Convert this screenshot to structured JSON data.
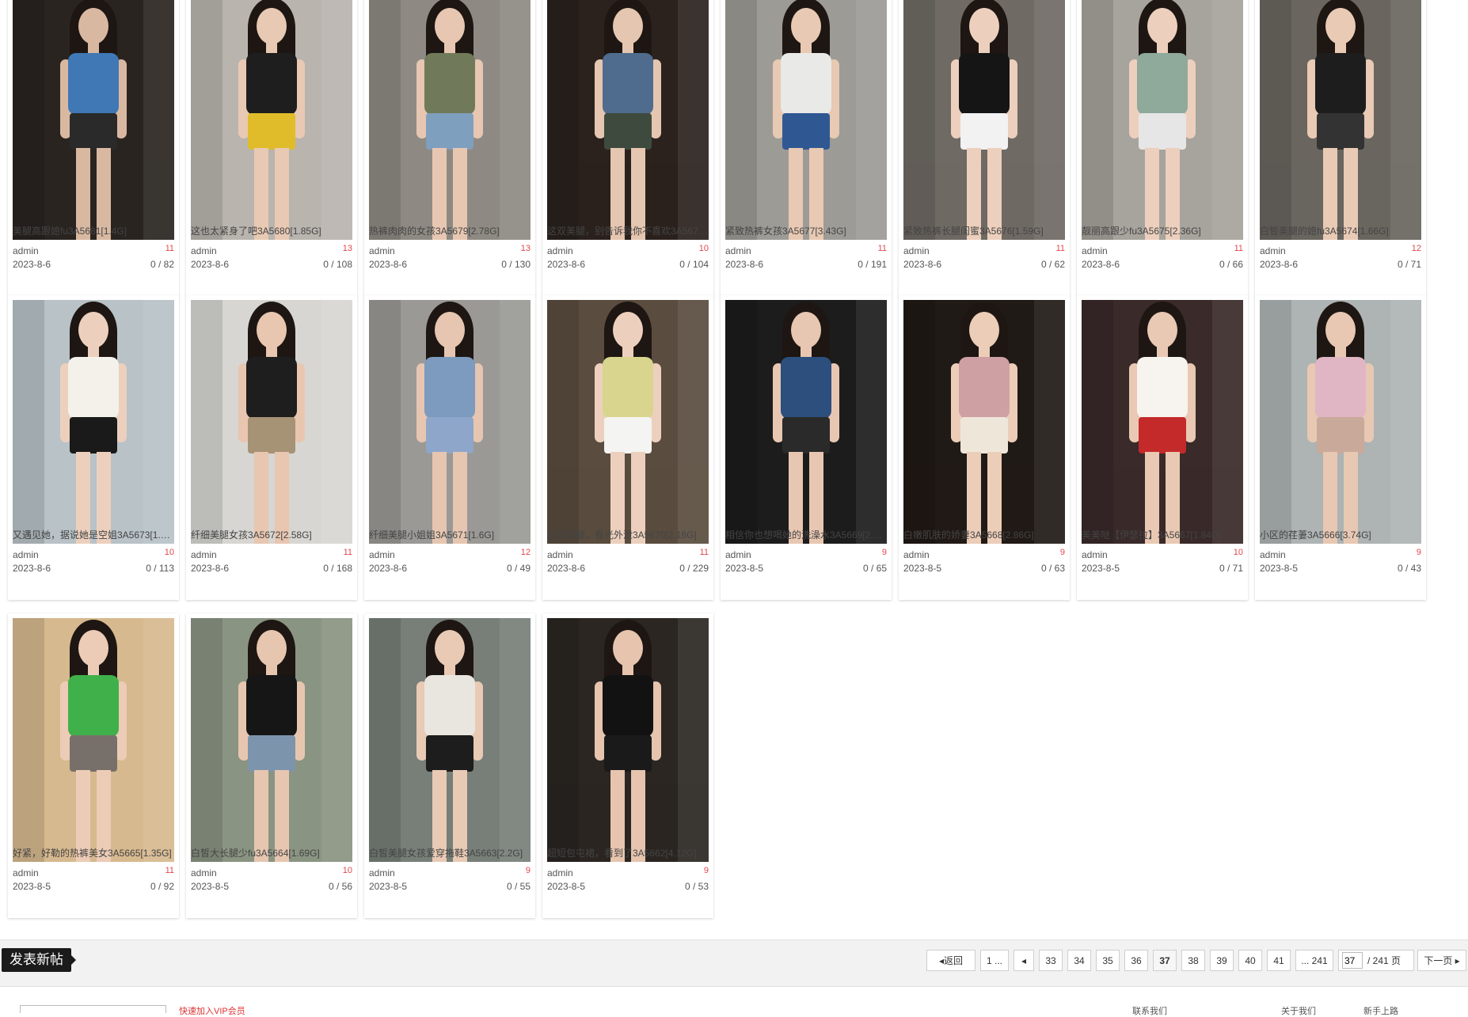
{
  "posts": [
    {
      "title": "美腿高跟媳fu3A5681[1.4G]",
      "author": "admin",
      "date": "2023-8-6",
      "count": "11",
      "stats": "0 / 82",
      "palette": [
        "#2a2420",
        "#3f78b5",
        "#d9b8a2",
        "#2a2a2a"
      ]
    },
    {
      "title": "这也太紧身了吧3A5680[1.85G]",
      "author": "admin",
      "date": "2023-8-6",
      "count": "13",
      "stats": "0 / 108",
      "palette": [
        "#b9b4ae",
        "#1e1e1e",
        "#e8c9b3",
        "#e0bc2b"
      ]
    },
    {
      "title": "热裤肉肉的女孩3A5679[2.78G]",
      "author": "admin",
      "date": "2023-8-6",
      "count": "13",
      "stats": "0 / 130",
      "palette": [
        "#8e8a83",
        "#707a5a",
        "#e7c7b2",
        "#7f9fbf"
      ]
    },
    {
      "title": "这双美腿，别告诉我你不喜欢3A5678[1.63G]",
      "author": "admin",
      "date": "2023-8-6",
      "count": "10",
      "stats": "0 / 104",
      "palette": [
        "#2b221e",
        "#4f6c8e",
        "#e5c6b0",
        "#3e4a3e"
      ]
    },
    {
      "title": "紧致热裤女孩3A5677[3.43G]",
      "author": "admin",
      "date": "2023-8-6",
      "count": "11",
      "stats": "0 / 191",
      "palette": [
        "#9d9b96",
        "#e9e9e7",
        "#e8c9b3",
        "#2f5893"
      ]
    },
    {
      "title": "紧致热裤长腿闺蜜3A5676[1.59G]",
      "author": "admin",
      "date": "2023-8-6",
      "count": "11",
      "stats": "0 / 62",
      "palette": [
        "#6f6a64",
        "#151515",
        "#ecd0bd",
        "#f2f2f2"
      ]
    },
    {
      "title": "靓丽高跟少fu3A5675[2.36G]",
      "author": "admin",
      "date": "2023-8-6",
      "count": "11",
      "stats": "0 / 66",
      "palette": [
        "#a7a39d",
        "#8fa99b",
        "#eccfbd",
        "#e6e6e6"
      ]
    },
    {
      "title": "白皙美腿的媳fu3A5674[1.66G]",
      "author": "admin",
      "date": "2023-8-6",
      "count": "12",
      "stats": "0 / 71",
      "palette": [
        "#6a665f",
        "#1d1d1d",
        "#e9cab5",
        "#333333"
      ]
    },
    {
      "title": "又遇见她，据说她是空姐3A5673[1.52G]",
      "author": "admin",
      "date": "2023-8-6",
      "count": "10",
      "stats": "0 / 113",
      "palette": [
        "#b8c2c7",
        "#f4f1ea",
        "#ecd0bd",
        "#1a1a1a"
      ]
    },
    {
      "title": "纤细美腿女孩3A5672[2.58G]",
      "author": "admin",
      "date": "2023-8-6",
      "count": "11",
      "stats": "0 / 168",
      "palette": [
        "#d7d6d2",
        "#1e1e1e",
        "#e8c6b0",
        "#a69275"
      ]
    },
    {
      "title": "纤细美腿小姐姐3A5671[1.6G]",
      "author": "admin",
      "date": "2023-8-6",
      "count": "12",
      "stats": "0 / 49",
      "palette": [
        "#9a9995",
        "#7d9abf",
        "#e6c6b1",
        "#8ea6c9"
      ]
    },
    {
      "title": "白皙美腿，春光外泄3A5670[2.16G]",
      "author": "admin",
      "date": "2023-8-6",
      "count": "11",
      "stats": "0 / 229",
      "palette": [
        "#5a4c3f",
        "#d9d58e",
        "#ecd0bd",
        "#f4f4f2"
      ]
    },
    {
      "title": "相信你也想喝她的洗澡水3A5669[2.31G]",
      "author": "admin",
      "date": "2023-8-5",
      "count": "9",
      "stats": "0 / 65",
      "palette": [
        "#1c1c1c",
        "#2c4f7e",
        "#e8c7b2",
        "#2a2a2a"
      ]
    },
    {
      "title": "白嫩肌肤的娇妻3A5668[2.86G]",
      "author": "admin",
      "date": "2023-8-5",
      "count": "9",
      "stats": "0 / 63",
      "palette": [
        "#201a16",
        "#cfa0a3",
        "#eccdb8",
        "#efe6da"
      ]
    },
    {
      "title": "美美哒【伊瑟拉】3A5667[1.84G]",
      "author": "admin",
      "date": "2023-8-5",
      "count": "10",
      "stats": "0 / 71",
      "palette": [
        "#3a2a2a",
        "#f7f3ee",
        "#e9c9b4",
        "#c42a2a"
      ]
    },
    {
      "title": "小区的荏萋3A5666[3.74G]",
      "author": "admin",
      "date": "2023-8-5",
      "count": "9",
      "stats": "0 / 43",
      "palette": [
        "#aeb3b3",
        "#e0b5c4",
        "#e8c8b3",
        "#c9a999"
      ]
    },
    {
      "title": "好紧，好勒的热裤美女3A5665[1.35G]",
      "author": "admin",
      "date": "2023-8-5",
      "count": "11",
      "stats": "0 / 92",
      "palette": [
        "#d7b98f",
        "#3fb04a",
        "#ecccb6",
        "#77706a"
      ]
    },
    {
      "title": "白皙大长腿少fu3A5664[1.69G]",
      "author": "admin",
      "date": "2023-8-5",
      "count": "10",
      "stats": "0 / 56",
      "palette": [
        "#8a9482",
        "#161616",
        "#e7c6b0",
        "#7d94ad"
      ]
    },
    {
      "title": "白皙美腿女孩爱穿拖鞋3A5663[2.2G]",
      "author": "admin",
      "date": "2023-8-5",
      "count": "9",
      "stats": "0 / 55",
      "palette": [
        "#777f78",
        "#e9e6df",
        "#e9caB5",
        "#1d1d1d"
      ]
    },
    {
      "title": "超短包屯裙，看到了3A5662[4.12G]",
      "author": "admin",
      "date": "2023-8-5",
      "count": "9",
      "stats": "0 / 53",
      "palette": [
        "#2b2622",
        "#121212",
        "#e6c4ae",
        "#1a1a1a"
      ]
    }
  ],
  "bottom": {
    "new_post": "发表新帖",
    "pager": {
      "back": "返回",
      "first": "1 ...",
      "pages": [
        "33",
        "34",
        "35",
        "36",
        "37",
        "38",
        "39",
        "40",
        "41"
      ],
      "current": "37",
      "last": "... 241",
      "input_value": "37",
      "total": "/ 241 页",
      "next": "下一页"
    }
  },
  "footer": {
    "text1": "快速加入VIP会员",
    "text2": "联系我们",
    "text3": "关于我们",
    "text4": "新手上路"
  },
  "colors": {
    "count": "#e0474c",
    "button_bg": "#1b1b1b"
  }
}
